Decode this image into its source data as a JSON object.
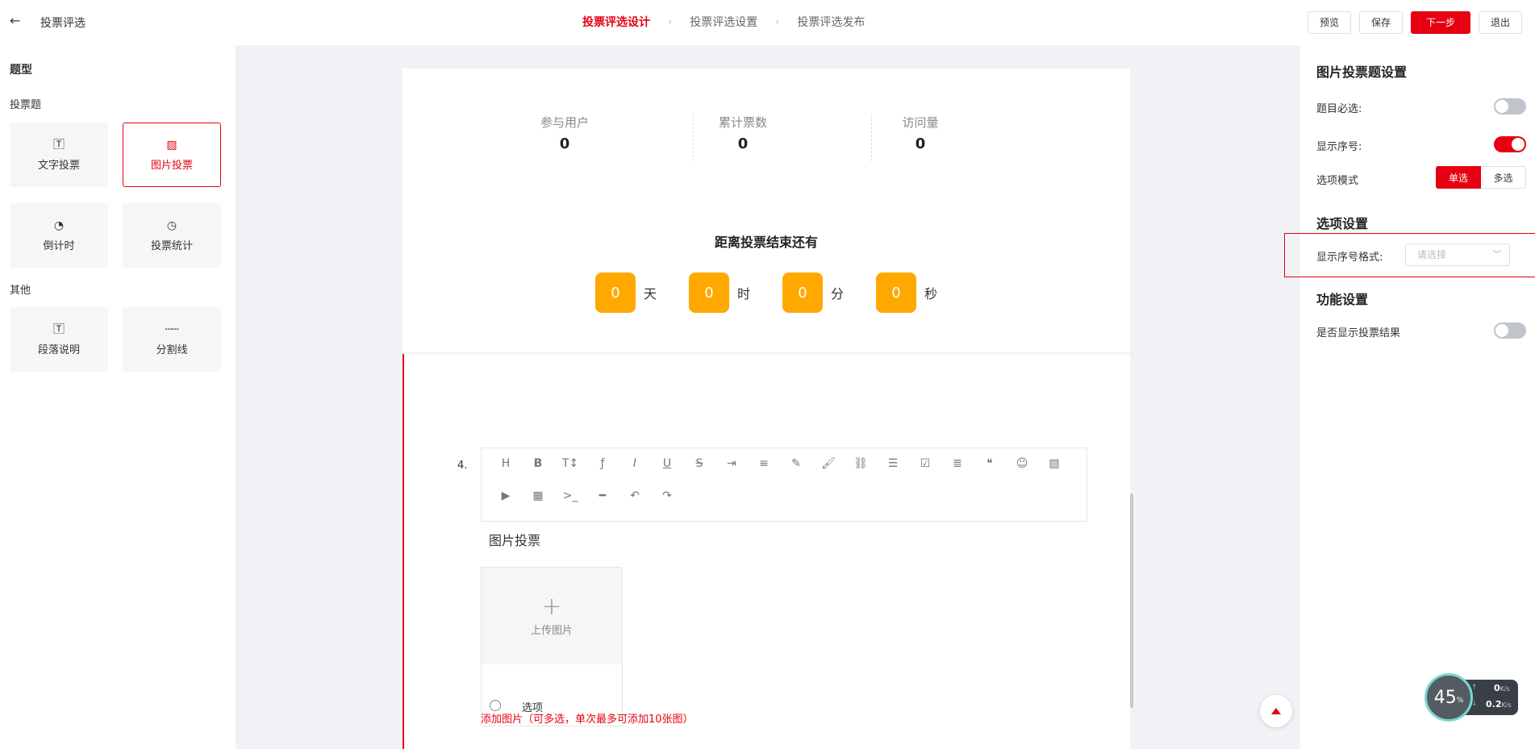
{
  "header": {
    "back_icon": "arrow-left-icon",
    "title": "投票评选",
    "steps": [
      "投票评选设计",
      "投票评选设置",
      "投票评选发布"
    ],
    "active_step": 0,
    "buttons": {
      "preview": "预览",
      "save": "保存",
      "next": "下一步",
      "exit": "退出"
    }
  },
  "left": {
    "title": "题型",
    "section_vote": "投票题",
    "section_other": "其他",
    "tiles_vote": [
      {
        "icon": "text-vote-icon",
        "label": "文字投票"
      },
      {
        "icon": "image-vote-icon",
        "label": "图片投票"
      },
      {
        "icon": "timer-icon",
        "label": "倒计时"
      },
      {
        "icon": "pie-chart-icon",
        "label": "投票统计"
      }
    ],
    "tiles_other": [
      {
        "icon": "paragraph-icon",
        "label": "段落说明"
      },
      {
        "icon": "divider-icon",
        "label": "分割线"
      }
    ]
  },
  "stats": [
    {
      "label": "参与用户",
      "value": "0"
    },
    {
      "label": "累计票数",
      "value": "0"
    },
    {
      "label": "访问量",
      "value": "0"
    }
  ],
  "countdown": {
    "title": "距离投票结束还有",
    "items": [
      {
        "value": "0",
        "unit": "天"
      },
      {
        "value": "0",
        "unit": "时"
      },
      {
        "value": "0",
        "unit": "分"
      },
      {
        "value": "0",
        "unit": "秒"
      }
    ]
  },
  "question": {
    "number": "4.",
    "text": "图片投票",
    "upload_label": "上传图片",
    "option_label": "选项",
    "add_hint": "添加图片（可多选，单次最多可添加10张图）"
  },
  "right": {
    "title": "图片投票题设置",
    "required_label": "题目必选:",
    "required_on": false,
    "show_index_label": "显示序号:",
    "show_index_on": true,
    "mode_label": "选项模式",
    "mode_single": "单选",
    "mode_multi": "多选",
    "option_settings": "选项设置",
    "index_format_label": "显示序号格式:",
    "index_format_placeholder": "请选择",
    "function_settings": "功能设置",
    "show_result_label": "是否显示投票结果",
    "show_result_on": false
  },
  "speed_widget": {
    "percent": "45",
    "percent_unit": "%",
    "up": "0",
    "up_unit": "K/s",
    "down": "0.2",
    "down_unit": "K/s"
  },
  "colors": {
    "accent": "#e60012",
    "countdown": "#ffa800"
  }
}
